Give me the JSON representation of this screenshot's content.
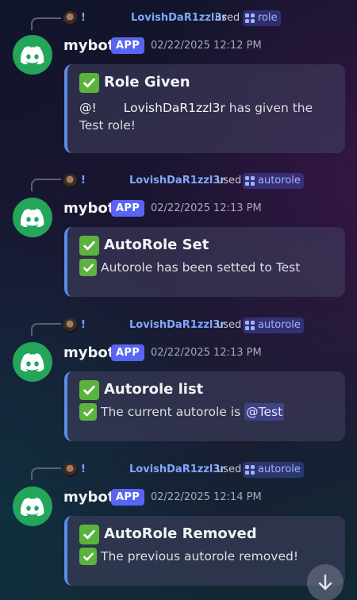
{
  "messages": [
    {
      "reply": {
        "prefix": "!",
        "user": "LovishDaR1zzl3r",
        "used_text": "used",
        "command": "role"
      },
      "author": {
        "name": "mybot",
        "badge": "APP"
      },
      "timestamp": "02/22/2025 12:12 PM",
      "embed": {
        "title": "Role Given",
        "mention": "@!",
        "mention_user": "LovishDaR1zzl3r",
        "text": "has given the Test role!"
      }
    },
    {
      "reply": {
        "prefix": "!",
        "user": "LovishDaR1zzl3r",
        "used_text": "used",
        "command": "autorole"
      },
      "author": {
        "name": "mybot",
        "badge": "APP"
      },
      "timestamp": "02/22/2025 12:13 PM",
      "embed": {
        "title": "AutoRole Set",
        "text": "Autorole has been setted to Test"
      }
    },
    {
      "reply": {
        "prefix": "!",
        "user": "LovishDaR1zzl3r",
        "used_text": "used",
        "command": "autorole"
      },
      "author": {
        "name": "mybot",
        "badge": "APP"
      },
      "timestamp": "02/22/2025 12:13 PM",
      "embed": {
        "title": "Autorole list",
        "text": "The current autorole is",
        "role_mention": "@Test"
      }
    },
    {
      "reply": {
        "prefix": "!",
        "user": "LovishDaR1zzl3r",
        "used_text": "used",
        "command": "autorole"
      },
      "author": {
        "name": "mybot",
        "badge": "APP"
      },
      "timestamp": "02/22/2025 12:14 PM",
      "embed": {
        "title": "AutoRole Removed",
        "text": "The previous autorole removed!"
      }
    }
  ],
  "icons": {
    "bot_avatar": "discord-logo-icon",
    "check": "white-check-mark-icon",
    "command": "app-command-icon",
    "jump": "arrow-down-icon"
  },
  "colors": {
    "app_badge": "#5865f2",
    "bot_avatar_bg": "#23a55a",
    "check_bg": "#5bb33d",
    "embed_border": "#5a8be6",
    "link": "#7fa8ff"
  }
}
